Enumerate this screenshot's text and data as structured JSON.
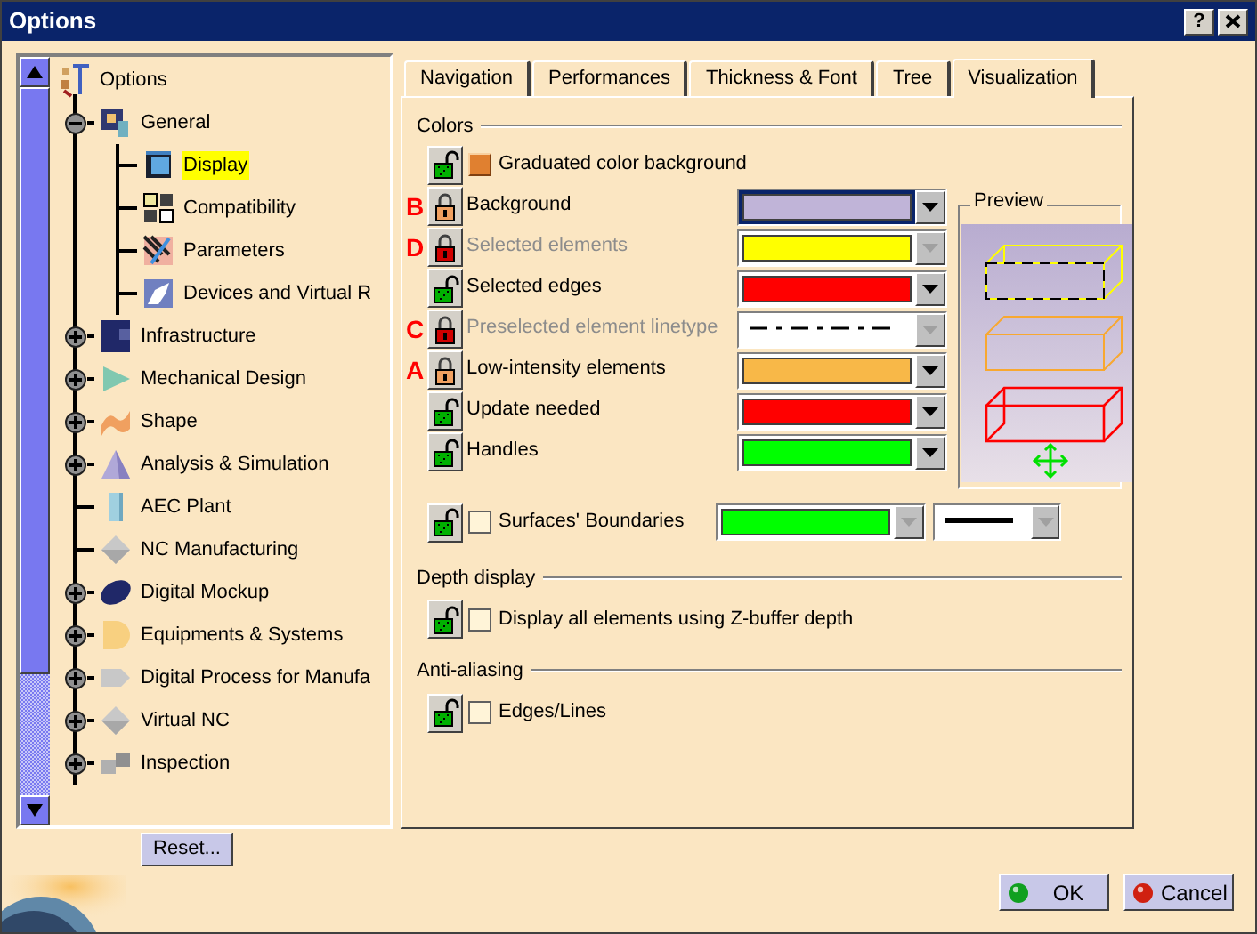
{
  "window": {
    "title": "Options",
    "help_button": "?"
  },
  "tree": {
    "label": "Options",
    "selected": false,
    "children": [
      {
        "label": "General",
        "kind": "node",
        "expanded": true,
        "selected": false,
        "children": [
          {
            "label": "Display",
            "kind": "leaf",
            "selected": true
          },
          {
            "label": "Compatibility",
            "kind": "leaf",
            "selected": false
          },
          {
            "label": "Parameters",
            "kind": "leaf",
            "selected": false
          },
          {
            "label": "Devices and Virtual R",
            "kind": "leaf",
            "selected": false
          }
        ]
      },
      {
        "label": "Infrastructure",
        "kind": "node",
        "expanded": false,
        "selected": false
      },
      {
        "label": "Mechanical Design",
        "kind": "node",
        "expanded": false,
        "selected": false
      },
      {
        "label": "Shape",
        "kind": "node",
        "expanded": false,
        "selected": false
      },
      {
        "label": "Analysis & Simulation",
        "kind": "node",
        "expanded": false,
        "selected": false
      },
      {
        "label": "AEC Plant",
        "kind": "leaf",
        "selected": false
      },
      {
        "label": "NC Manufacturing",
        "kind": "leaf",
        "selected": false
      },
      {
        "label": "Digital Mockup",
        "kind": "node",
        "expanded": false,
        "selected": false
      },
      {
        "label": "Equipments & Systems",
        "kind": "node",
        "expanded": false,
        "selected": false
      },
      {
        "label": "Digital Process for Manufa",
        "kind": "node",
        "expanded": false,
        "selected": false
      },
      {
        "label": "Virtual NC",
        "kind": "node",
        "expanded": false,
        "selected": false
      },
      {
        "label": "Inspection",
        "kind": "node",
        "expanded": false,
        "selected": false
      }
    ]
  },
  "reset_button": "Reset...",
  "tabs": [
    {
      "label": "Navigation",
      "selected": false
    },
    {
      "label": "Performances",
      "selected": false
    },
    {
      "label": "Thickness & Font",
      "selected": false
    },
    {
      "label": "Tree",
      "selected": false
    },
    {
      "label": "Visualization",
      "selected": true
    }
  ],
  "colors": {
    "title": "Colors",
    "graduated": {
      "label": "Graduated color background",
      "checked": true,
      "lock": {
        "locked": false,
        "color": "#00b000"
      }
    },
    "rows": [
      {
        "marker": "B",
        "lock": {
          "locked": true,
          "color": "#f0a060"
        },
        "label": "Background",
        "disabled": false,
        "kind": "color",
        "color": "#c0b4d8",
        "focused": true
      },
      {
        "marker": "D",
        "lock": {
          "locked": true,
          "color": "#d00000"
        },
        "label": "Selected elements",
        "disabled": true,
        "kind": "color",
        "color": "#ffff00",
        "focused": false
      },
      {
        "lock": {
          "locked": false,
          "color": "#00b000"
        },
        "label": "Selected edges",
        "disabled": false,
        "kind": "color",
        "color": "#ff0000",
        "focused": false
      },
      {
        "marker": "C",
        "lock": {
          "locked": true,
          "color": "#d00000"
        },
        "label": "Preselected element linetype",
        "disabled": true,
        "kind": "linetype",
        "focused": false
      },
      {
        "marker": "A",
        "lock": {
          "locked": true,
          "color": "#f0a060"
        },
        "label": "Low-intensity elements",
        "disabled": false,
        "kind": "color",
        "color": "#f8b848",
        "focused": false
      },
      {
        "lock": {
          "locked": false,
          "color": "#00b000"
        },
        "label": "Update needed",
        "disabled": false,
        "kind": "color",
        "color": "#ff0000",
        "focused": false
      },
      {
        "lock": {
          "locked": false,
          "color": "#00b000"
        },
        "label": "Handles",
        "disabled": false,
        "kind": "color",
        "color": "#00ff00",
        "focused": false
      }
    ],
    "preview": {
      "title": "Preview"
    }
  },
  "surfaces": {
    "lock": {
      "locked": false,
      "color": "#00b000"
    },
    "label": "Surfaces' Boundaries",
    "checked": false,
    "color": "#00ff00",
    "disabled": true
  },
  "depth": {
    "title": "Depth display",
    "option": {
      "lock": {
        "locked": false,
        "color": "#00b000"
      },
      "label": "Display all elements using Z-buffer depth",
      "checked": false
    }
  },
  "antialiasing": {
    "title": "Anti-aliasing",
    "option": {
      "lock": {
        "locked": false,
        "color": "#00b000"
      },
      "label": "Edges/Lines",
      "checked": false
    }
  },
  "buttons": [
    {
      "label": "OK",
      "kind": "ok"
    },
    {
      "label": "Cancel",
      "kind": "cancel"
    }
  ]
}
